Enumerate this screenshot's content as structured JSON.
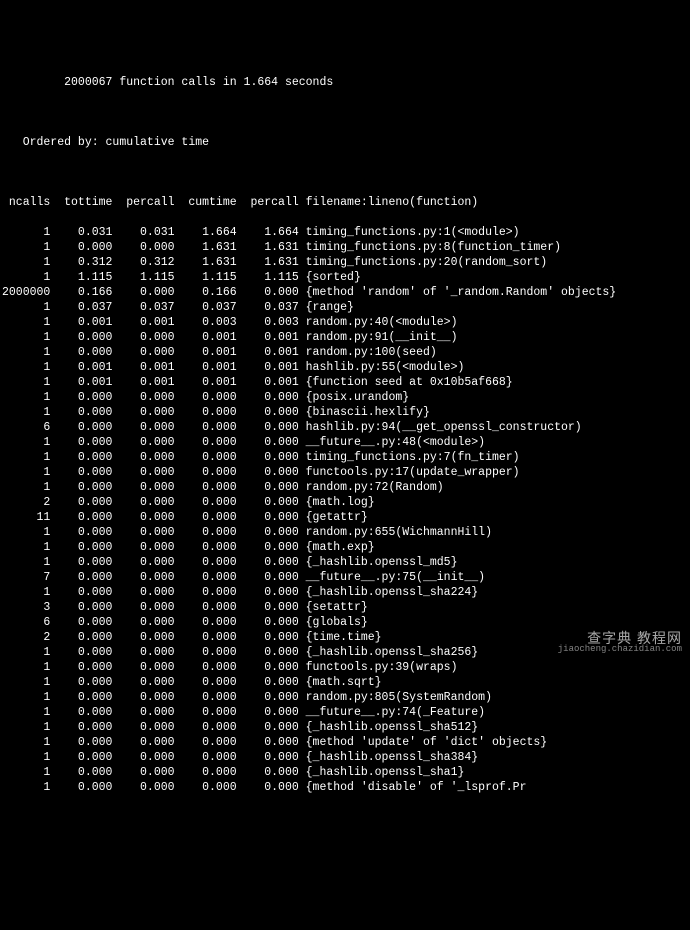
{
  "header": {
    "summary": "         2000067 function calls in 1.664 seconds",
    "ordered_by": "   Ordered by: cumulative time"
  },
  "columns": " ncalls  tottime  percall  cumtime  percall filename:lineno(function)",
  "rows": [
    "      1    0.031    0.031    1.664    1.664 timing_functions.py:1(<module>)",
    "      1    0.000    0.000    1.631    1.631 timing_functions.py:8(function_timer)",
    "      1    0.312    0.312    1.631    1.631 timing_functions.py:20(random_sort)",
    "      1    1.115    1.115    1.115    1.115 {sorted}",
    "2000000    0.166    0.000    0.166    0.000 {method 'random' of '_random.Random' objects}",
    "      1    0.037    0.037    0.037    0.037 {range}",
    "      1    0.001    0.001    0.003    0.003 random.py:40(<module>)",
    "      1    0.000    0.000    0.001    0.001 random.py:91(__init__)",
    "      1    0.000    0.000    0.001    0.001 random.py:100(seed)",
    "      1    0.001    0.001    0.001    0.001 hashlib.py:55(<module>)",
    "      1    0.001    0.001    0.001    0.001 {function seed at 0x10b5af668}",
    "      1    0.000    0.000    0.000    0.000 {posix.urandom}",
    "      1    0.000    0.000    0.000    0.000 {binascii.hexlify}",
    "      6    0.000    0.000    0.000    0.000 hashlib.py:94(__get_openssl_constructor)",
    "      1    0.000    0.000    0.000    0.000 __future__.py:48(<module>)",
    "      1    0.000    0.000    0.000    0.000 timing_functions.py:7(fn_timer)",
    "      1    0.000    0.000    0.000    0.000 functools.py:17(update_wrapper)",
    "      1    0.000    0.000    0.000    0.000 random.py:72(Random)",
    "      2    0.000    0.000    0.000    0.000 {math.log}",
    "     11    0.000    0.000    0.000    0.000 {getattr}",
    "      1    0.000    0.000    0.000    0.000 random.py:655(WichmannHill)",
    "      1    0.000    0.000    0.000    0.000 {math.exp}",
    "      1    0.000    0.000    0.000    0.000 {_hashlib.openssl_md5}",
    "      7    0.000    0.000    0.000    0.000 __future__.py:75(__init__)",
    "      1    0.000    0.000    0.000    0.000 {_hashlib.openssl_sha224}",
    "      3    0.000    0.000    0.000    0.000 {setattr}",
    "      6    0.000    0.000    0.000    0.000 {globals}",
    "      2    0.000    0.000    0.000    0.000 {time.time}",
    "      1    0.000    0.000    0.000    0.000 {_hashlib.openssl_sha256}",
    "      1    0.000    0.000    0.000    0.000 functools.py:39(wraps)",
    "      1    0.000    0.000    0.000    0.000 {math.sqrt}",
    "      1    0.000    0.000    0.000    0.000 random.py:805(SystemRandom)",
    "      1    0.000    0.000    0.000    0.000 __future__.py:74(_Feature)",
    "      1    0.000    0.000    0.000    0.000 {_hashlib.openssl_sha512}",
    "      1    0.000    0.000    0.000    0.000 {method 'update' of 'dict' objects}",
    "      1    0.000    0.000    0.000    0.000 {_hashlib.openssl_sha384}",
    "      1    0.000    0.000    0.000    0.000 {_hashlib.openssl_sha1}",
    "      1    0.000    0.000    0.000    0.000 {method 'disable' of '_lsprof.Pr"
  ],
  "watermark": {
    "main": "查字典 教程网",
    "sub": "jiaocheng.chazidian.com"
  }
}
